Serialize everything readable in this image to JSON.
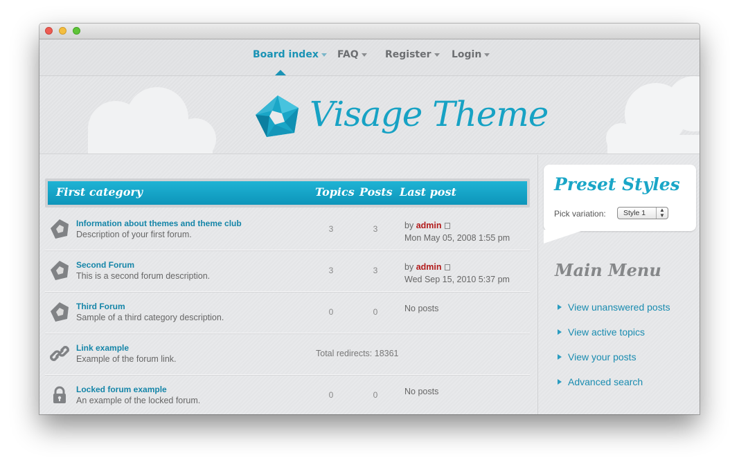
{
  "nav": {
    "items": [
      {
        "label": "Board index",
        "active": true
      },
      {
        "label": "FAQ",
        "active": false
      },
      {
        "label": "Register",
        "active": false
      },
      {
        "label": "Login",
        "active": false
      }
    ]
  },
  "banner": {
    "logo_text": "Visage Theme"
  },
  "category": {
    "title": "First category",
    "col_topics": "Topics",
    "col_posts": "Posts",
    "col_last": "Last post"
  },
  "forums": [
    {
      "title": "Information about themes and theme club",
      "desc": "Description of your first forum.",
      "topics": "3",
      "posts": "3",
      "by": "by",
      "author": "admin",
      "date": "Mon May 05, 2008 1:55 pm",
      "icon": "forum-read-icon"
    },
    {
      "title": "Second Forum",
      "desc": "This is a second forum description.",
      "topics": "3",
      "posts": "3",
      "by": "by",
      "author": "admin",
      "date": "Wed Sep 15, 2010 5:37 pm",
      "icon": "forum-read-icon"
    },
    {
      "title": "Third Forum",
      "desc": "Sample of a third category description.",
      "topics": "0",
      "posts": "0",
      "last": "No posts",
      "icon": "forum-read-icon"
    },
    {
      "title": "Link example",
      "desc": "Example of the forum link.",
      "redirects": "Total redirects: 18361",
      "icon": "link-icon"
    },
    {
      "title": "Locked forum example",
      "desc": "An example of the locked forum.",
      "topics": "0",
      "posts": "0",
      "last": "No posts",
      "icon": "lock-icon"
    }
  ],
  "sidebar": {
    "preset_title": "Preset Styles",
    "pick_label": "Pick variation:",
    "selected_style": "Style 1",
    "menu_title": "Main Menu",
    "menu_items": [
      "View unanswered posts",
      "View active topics",
      "View your posts",
      "Advanced search"
    ]
  },
  "colors": {
    "accent": "#1aa6c7",
    "author": "#b21a1a",
    "link": "#1585a8"
  }
}
